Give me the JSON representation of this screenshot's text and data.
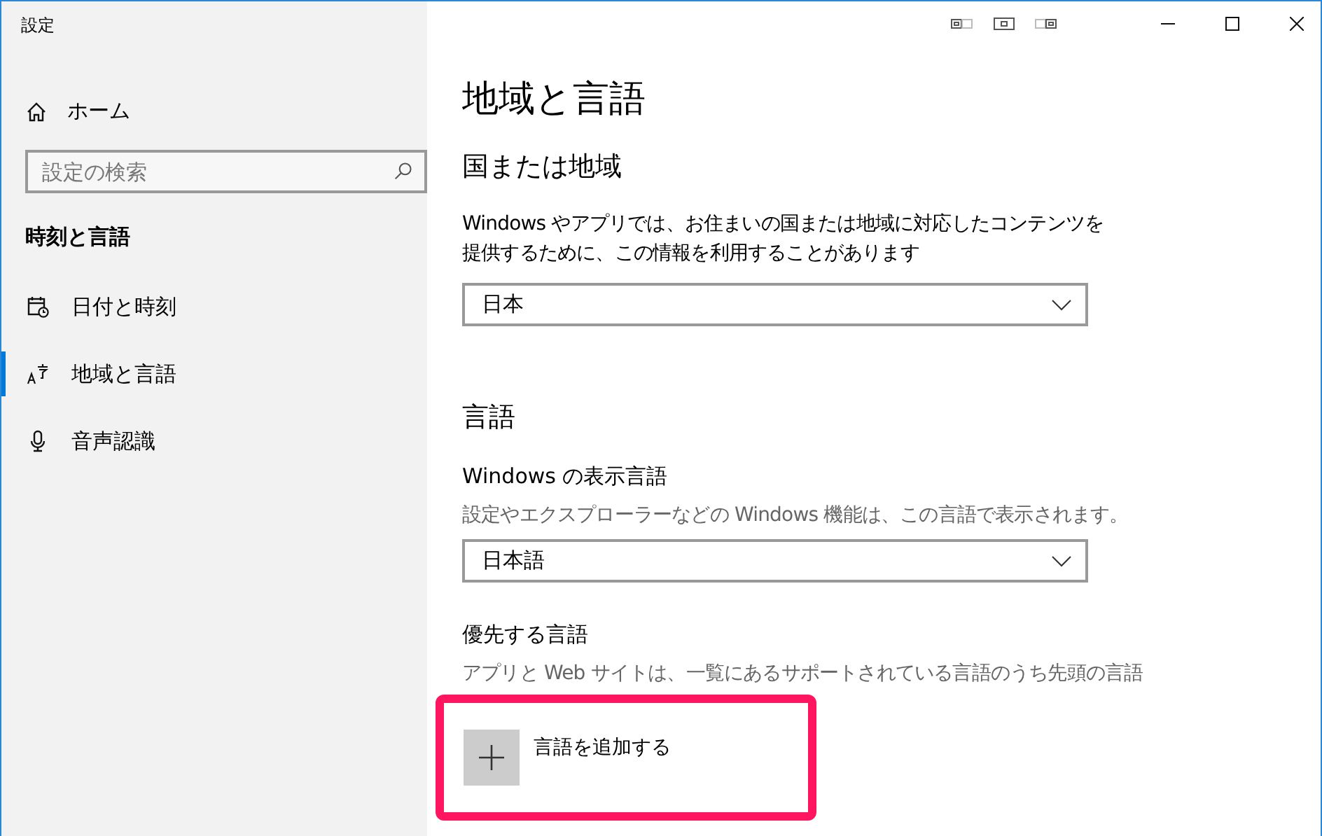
{
  "window": {
    "title": "設定",
    "caption_buttons": [
      {
        "kind": "minimize"
      },
      {
        "kind": "maximize"
      },
      {
        "kind": "close"
      }
    ]
  },
  "sidebar": {
    "home": "ホーム",
    "search": {
      "placeholder": "設定の検索"
    },
    "section": "時刻と言語",
    "items": [
      {
        "label": "日付と時刻",
        "kind": "calendar",
        "selected": false
      },
      {
        "label": "地域と言語",
        "kind": "language",
        "selected": true
      },
      {
        "label": "音声認識",
        "kind": "microphone",
        "selected": false
      }
    ]
  },
  "main": {
    "title": "地域と言語",
    "region": {
      "heading": "国または地域",
      "description": "Windows やアプリでは、お住まいの国または地域に対応したコンテンツを提供するために、この情報を利用することがあります",
      "dropdown": "日本"
    },
    "language": {
      "heading": "言語",
      "display_label": "Windows の表示言語",
      "display_description": "設定やエクスプローラーなどの Windows 機能は、この言語で表示されます。",
      "dropdown": "日本語",
      "preferred_label": "優先する言語",
      "preferred_description": "アプリと Web サイトは、一覧にあるサポートされている言語のうち先頭の言語",
      "add_button": {
        "label": "言語を追加する",
        "highlighted": true
      }
    }
  }
}
